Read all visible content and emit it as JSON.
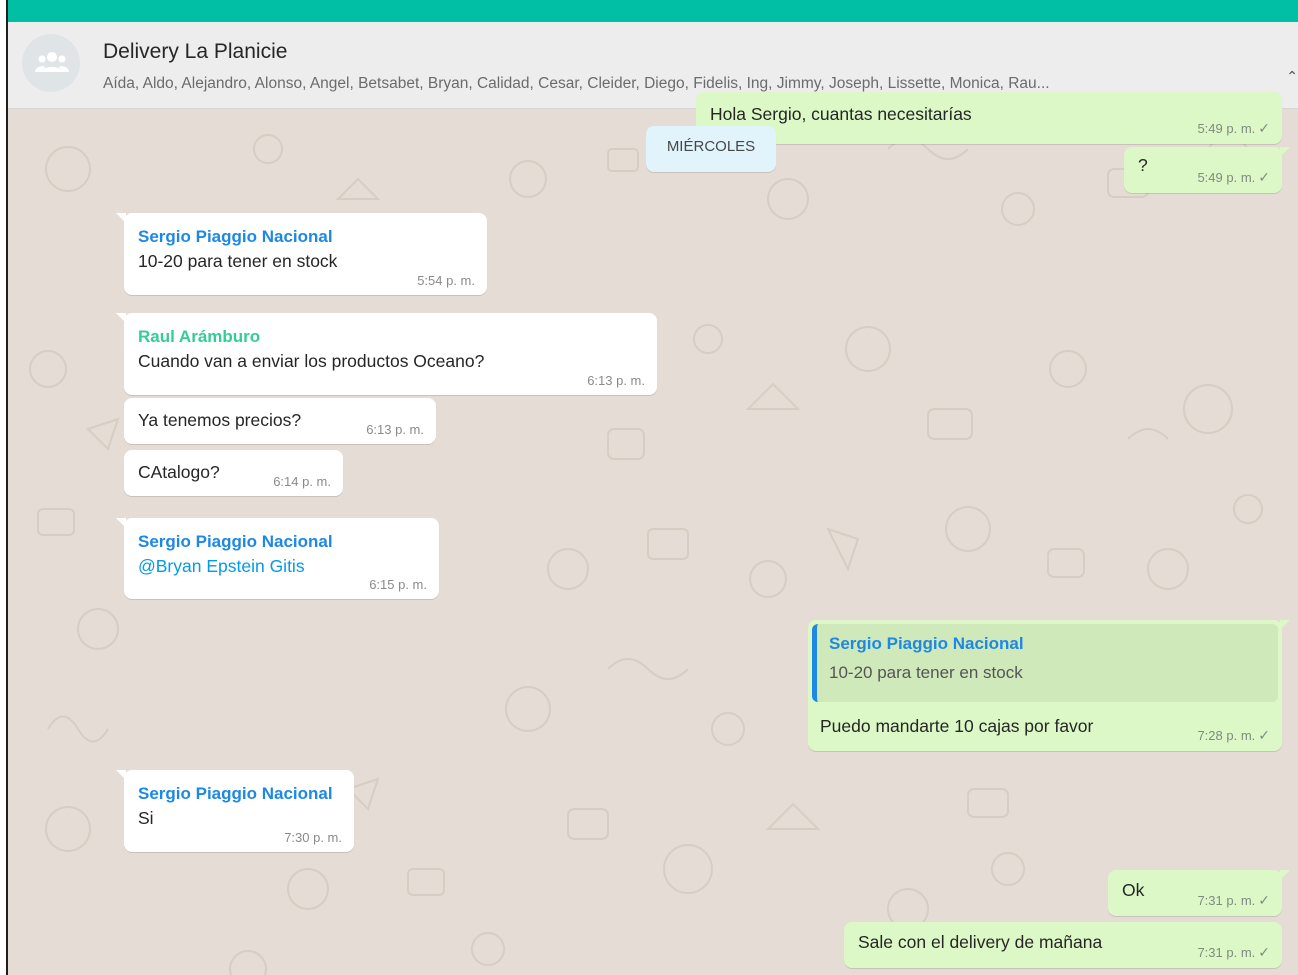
{
  "header": {
    "title": "Delivery La Planicie",
    "participants": "Aída, Aldo, Alejandro, Alonso, Angel, Betsabet, Bryan, Calidad, Cesar, Cleider, Diego, Fidelis, Ing, Jimmy, Joseph, Lissette, Monica, Rau...",
    "avatar_icon": "group-icon"
  },
  "date_divider": "MIÉRCOLES",
  "messages": [
    {
      "dir": "out",
      "text": "Hola Sergio, cuantas necesitarías",
      "time": "5:49 p. m.",
      "status_icon": "single-check-icon"
    },
    {
      "dir": "out",
      "text": "?",
      "time": "5:49 p. m.",
      "status_icon": "single-check-icon"
    },
    {
      "dir": "in",
      "sender": "Sergio Piaggio Nacional",
      "sender_color": "#1e88e5",
      "text": "10-20 para tener en stock",
      "time": "5:54 p. m."
    },
    {
      "dir": "in",
      "sender": "Raul Arámburo",
      "sender_color": "#35cd96",
      "text": "Cuando van a enviar los productos Oceano?",
      "time": "6:13 p. m."
    },
    {
      "dir": "in",
      "text": "Ya tenemos precios?",
      "time": "6:13 p. m."
    },
    {
      "dir": "in",
      "text": "CAtalogo?",
      "time": "6:14 p. m."
    },
    {
      "dir": "in",
      "sender": "Sergio Piaggio Nacional",
      "sender_color": "#1e88e5",
      "mention": "@Bryan Epstein Gitis",
      "time": "6:15 p. m."
    },
    {
      "dir": "out",
      "quote": {
        "sender": "Sergio Piaggio Nacional",
        "text": "10-20 para tener en stock"
      },
      "text": "Puedo mandarte 10 cajas por favor",
      "time": "7:28 p. m.",
      "status_icon": "single-check-icon"
    },
    {
      "dir": "in",
      "sender": "Sergio Piaggio Nacional",
      "sender_color": "#1e88e5",
      "text": "Si",
      "time": "7:30 p. m."
    },
    {
      "dir": "out",
      "text": "Ok",
      "time": "7:31 p. m.",
      "status_icon": "single-check-icon"
    },
    {
      "dir": "out",
      "text": "Sale con el delivery de mañana",
      "time": "7:31 p. m.",
      "status_icon": "single-check-icon"
    }
  ],
  "colors": {
    "accent": "#00bfa5",
    "outgoing_bubble": "#dcf8c6",
    "incoming_bubble": "#ffffff",
    "chat_background": "#e5ddd5",
    "date_pill": "#e1f3fb",
    "mention": "#039be5"
  }
}
